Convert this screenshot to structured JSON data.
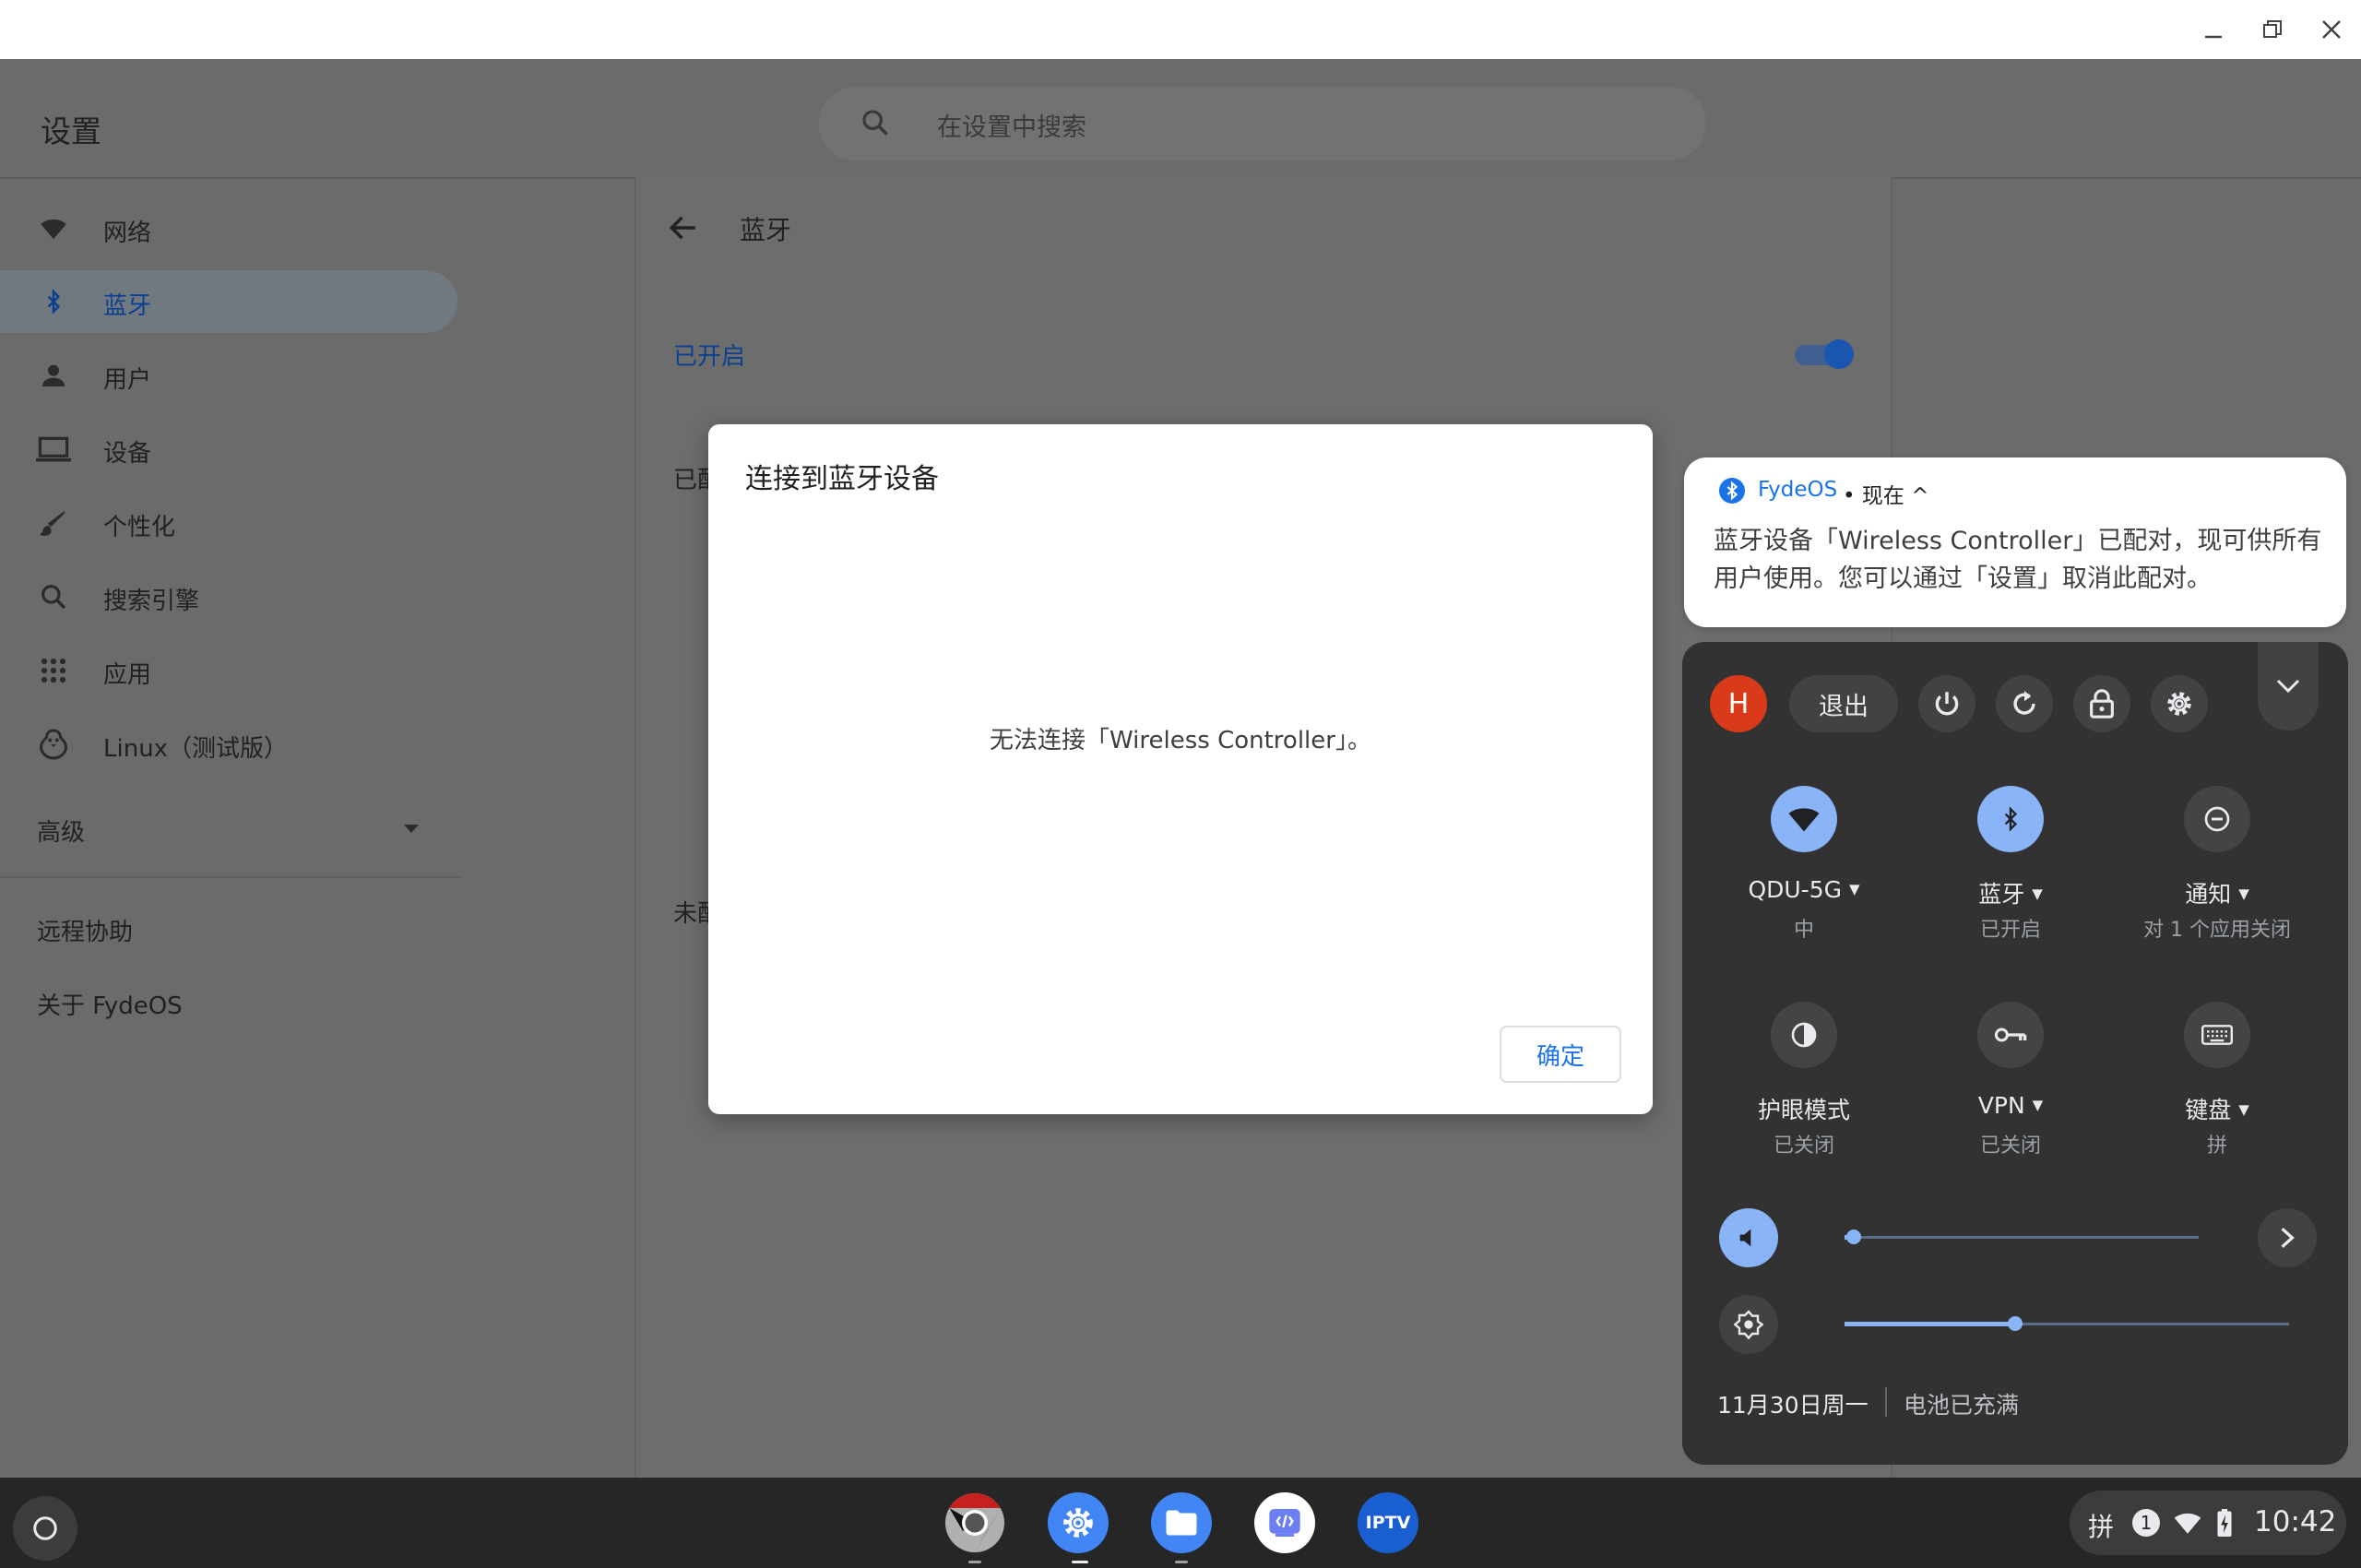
{
  "settings": {
    "title": "设置",
    "search_placeholder": "在设置中搜索"
  },
  "sidebar": {
    "items": [
      {
        "label": "网络",
        "icon": "wifi-icon"
      },
      {
        "label": "蓝牙",
        "icon": "bluetooth-icon",
        "active": true
      },
      {
        "label": "用户",
        "icon": "person-icon"
      },
      {
        "label": "设备",
        "icon": "laptop-icon"
      },
      {
        "label": "个性化",
        "icon": "brush-icon"
      },
      {
        "label": "搜索引擎",
        "icon": "search-icon"
      },
      {
        "label": "应用",
        "icon": "apps-grid-icon"
      },
      {
        "label": "Linux（测试版）",
        "icon": "penguin-icon"
      }
    ],
    "advanced": "高级",
    "remote": "远程协助",
    "about": "关于 FydeOS"
  },
  "bluetooth_page": {
    "title": "蓝牙",
    "toggle_label": "已开启",
    "toggle_on": true,
    "paired_partial": "已配",
    "unpaired_partial": "未配"
  },
  "dialog": {
    "title": "连接到蓝牙设备",
    "message": "无法连接「Wireless Controller」。",
    "ok": "确定"
  },
  "notification": {
    "app": "FydeOS",
    "when": "• 现在 ^",
    "body": "蓝牙设备「Wireless Controller」已配对，现可供所有用户使用。您可以通过「设置」取消此配对。"
  },
  "quick_settings": {
    "avatar": "H",
    "sign_out": "退出",
    "pods": [
      {
        "label": "QDU-5G",
        "sub": "中",
        "icon": "wifi-icon",
        "on": true
      },
      {
        "label": "蓝牙",
        "sub": "已开启",
        "icon": "bluetooth-icon",
        "on": true
      },
      {
        "label": "通知",
        "sub": "对 1 个应用关闭",
        "icon": "do-not-disturb-icon",
        "on": false
      },
      {
        "label": "护眼模式",
        "sub": "已关闭",
        "icon": "night-light-icon",
        "on": false
      },
      {
        "label": "VPN",
        "sub": "已关闭",
        "icon": "vpn-key-icon",
        "on": false
      },
      {
        "label": "键盘",
        "sub": "拼",
        "icon": "keyboard-icon",
        "on": false
      }
    ],
    "volume_level": 0.02,
    "brightness_level": 0.38,
    "date": "11月30日周一",
    "battery": "电池已充满"
  },
  "shelf": {
    "apps": [
      "chrome-icon",
      "settings-icon",
      "files-icon",
      "fydeos-app-icon",
      "iptv-icon"
    ],
    "iptv_label": "IPTV",
    "ime": "拼",
    "notif_count": "1",
    "time": "10:42"
  },
  "colors": {
    "accent": "#1a73e8",
    "toggle": "#1a56b0",
    "qs_active": "#8ab4f8",
    "avatar": "#d93a1a"
  }
}
